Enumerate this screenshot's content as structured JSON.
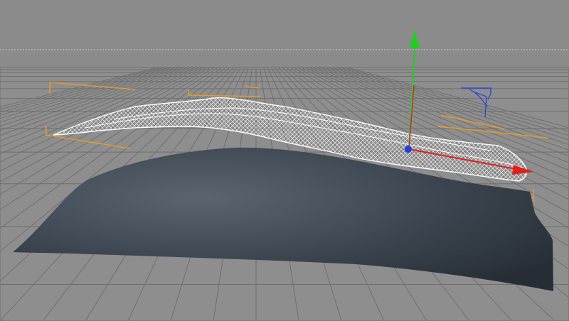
{
  "viewport": {
    "type": "3d-perspective-viewport",
    "background_color": "#8a8a8a",
    "grid_color": "#6f6f6f",
    "horizon_dash_color": "#c8c8c8",
    "grid": true
  },
  "objects": [
    {
      "name": "cloth-surface",
      "shading": "smooth",
      "color": "#3c4550"
    },
    {
      "name": "wireframe-mesh",
      "shading": "wireframe",
      "color": "#ffffff"
    }
  ],
  "gizmo": {
    "x_axis_color": "#e02020",
    "y_axis_color": "#20d020",
    "z_axis_color": "#2040e0"
  },
  "bounding_box_color": "#e09a30",
  "icons": [
    "move-gizmo-icon",
    "axis-indicator-icon"
  ]
}
